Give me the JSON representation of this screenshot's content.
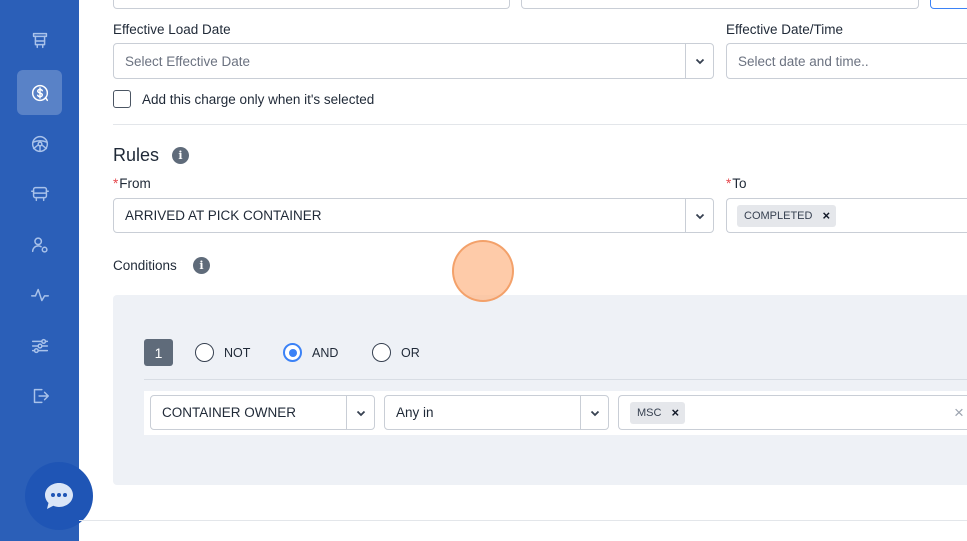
{
  "sidebar": {
    "items": [
      {
        "icon": "truck-front-icon",
        "active": false
      },
      {
        "icon": "dollar-circle-icon",
        "active": true
      },
      {
        "icon": "steering-wheel-icon",
        "active": false
      },
      {
        "icon": "bus-icon",
        "active": false
      },
      {
        "icon": "user-settings-icon",
        "active": false
      },
      {
        "icon": "activity-icon",
        "active": false
      },
      {
        "icon": "sliders-icon",
        "active": false
      },
      {
        "icon": "logout-icon",
        "active": false
      }
    ],
    "chat_icon": "chat-bubble-icon"
  },
  "form": {
    "effective_load_date": {
      "label": "Effective Load Date",
      "placeholder": "Select Effective Date"
    },
    "effective_datetime": {
      "label": "Effective Date/Time",
      "placeholder": "Select date and time.."
    },
    "selected_only_checkbox": {
      "label": "Add this charge only when it's selected",
      "checked": false
    }
  },
  "rules": {
    "title": "Rules",
    "from": {
      "required_mark": "*",
      "label": "From",
      "value": "ARRIVED AT PICK CONTAINER"
    },
    "to": {
      "required_mark": "*",
      "label": "To",
      "tags": [
        "COMPLETED"
      ]
    },
    "conditions_label": "Conditions",
    "group": {
      "number": "1",
      "operators": [
        {
          "label": "NOT",
          "selected": false
        },
        {
          "label": "AND",
          "selected": true
        },
        {
          "label": "OR",
          "selected": false
        }
      ],
      "condition": {
        "field": "CONTAINER OWNER",
        "operator": "Any in",
        "values": [
          "MSC"
        ]
      }
    }
  },
  "colors": {
    "sidebar": "#2b5fb8",
    "accent": "#3b82f6",
    "required": "#e5484d",
    "panel": "#eef1f6"
  }
}
